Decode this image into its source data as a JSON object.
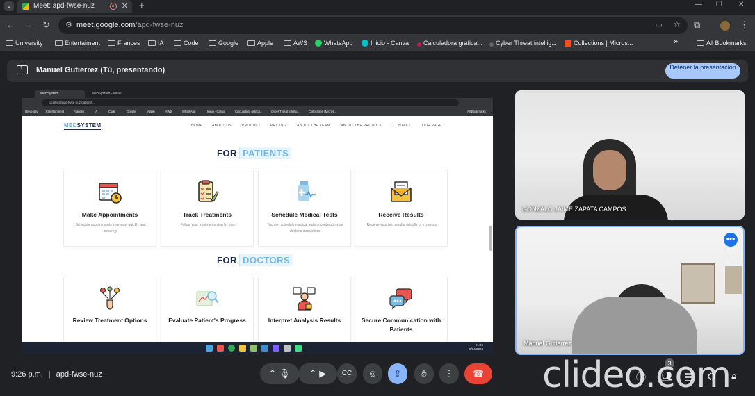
{
  "browser": {
    "tab_title": "Meet: apd-fwse-nuz",
    "tab_close": "✕",
    "new_tab": "+",
    "url_host": "meet.google.com",
    "url_path": "/apd-fwse-nuz",
    "bookmarks": [
      "University",
      "Entertaiment",
      "Frances",
      "IA",
      "Code",
      "Google",
      "Apple",
      "AWS",
      "WhatsApp",
      "Inicio - Canva",
      "Calculadora gráfica...",
      "Cyber Threat intellig...",
      "Collections | Micros..."
    ],
    "bookmarks_more": "»",
    "all_bookmarks": "All Bookmarks"
  },
  "meet": {
    "presenter_banner": "Manuel Gutierrez (Tú, presentando)",
    "stop_button": "Detener la presentación",
    "time": "9:26 p.m.",
    "meeting_code": "apd-fwse-nuz",
    "participants_count": "3",
    "participants": [
      {
        "name": "GONZALO JAIME ZAPATA CAMPOS"
      },
      {
        "name": "Manuel Gutierrez"
      }
    ],
    "watermark": "clideo.com"
  },
  "shared_screen": {
    "inner_tab_1": "MedSystem",
    "inner_tab_2": "MedSystem - Initial",
    "inner_url": "localhost/apd-fwse-nuz/patient/...",
    "inner_bookmarks": [
      "University",
      "Entertainment",
      "Frances",
      "IA",
      "Code",
      "Google",
      "Apple",
      "AWS",
      "WhatsApp",
      "Inicio - Canva",
      "Calculadora gráfica...",
      "Cyber Threat intellig...",
      "Collections | Micros...",
      "All Bookmarks"
    ],
    "inner_clock": [
      "21:26",
      "8/04/2024"
    ],
    "site": {
      "logo_accent": "MED",
      "logo_rest": "SYSTEM",
      "nav": [
        "HOME",
        "ABOUT US",
        "PRODUCT",
        "PRICING",
        "ABOUT THE TEAM",
        "ABOUT THE PRODUCT",
        "CONTACT",
        "OUR PAGE"
      ],
      "patients_prefix": "FOR",
      "patients_highlight": "PATIENTS",
      "doctors_prefix": "FOR",
      "doctors_highlight": "DOCTORS",
      "patient_cards": [
        {
          "title": "Make Appointments",
          "desc": "Schedule appointments your way, quickly and securely",
          "icon": "calendar-clock-icon"
        },
        {
          "title": "Track Treatments",
          "desc": "Follow your treatments step by step",
          "icon": "clipboard-check-icon"
        },
        {
          "title": "Schedule Medical Tests",
          "desc": "You can schedule medical tests according to your doctor's instructions",
          "icon": "medical-bottle-icon"
        },
        {
          "title": "Receive Results",
          "desc": "Receive your test results virtually or in person",
          "icon": "envelope-letter-icon"
        }
      ],
      "doctor_cards": [
        {
          "title": "Review Treatment Options",
          "icon": "decision-hand-icon"
        },
        {
          "title": "Evaluate Patient's Progress",
          "icon": "chart-magnifier-icon"
        },
        {
          "title": "Interpret Analysis Results",
          "icon": "doctor-translate-icon"
        },
        {
          "title": "Secure Communication with Patients",
          "icon": "chat-bubbles-icon"
        }
      ]
    }
  },
  "colors": {
    "accent_blue": "#a8c7fa",
    "hangup_red": "#ea4335",
    "site_highlight": "#6fb6ea",
    "site_navy": "#1f2b4d"
  }
}
